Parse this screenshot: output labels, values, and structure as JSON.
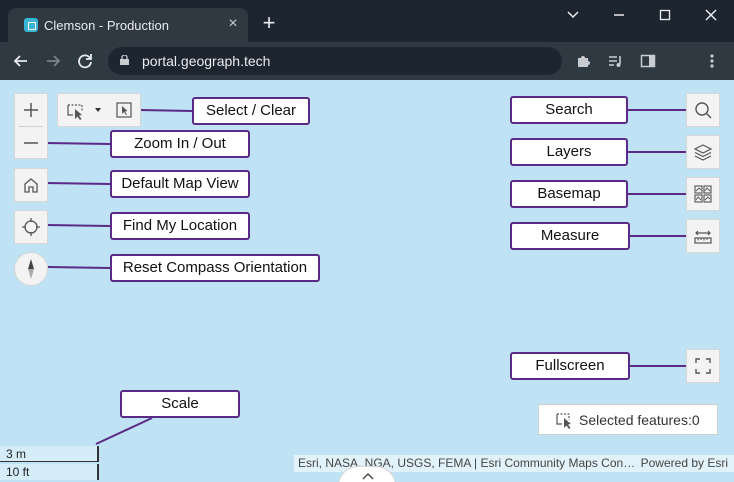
{
  "browser": {
    "tab_title": "Clemson - Production",
    "url": "portal.geograph.tech",
    "new_tab_label": "+",
    "tab_close_label": "×"
  },
  "map_controls": {
    "left": [
      "zoom-in",
      "zoom-out",
      "default-map-view",
      "find-my-location",
      "reset-compass"
    ],
    "right": [
      "search",
      "layers",
      "basemap",
      "measure",
      "fullscreen"
    ]
  },
  "callouts": {
    "select_clear": "Select / Clear",
    "zoom": "Zoom In / Out",
    "default_view": "Default Map View",
    "find_location": "Find My Location",
    "reset_compass": "Reset Compass Orientation",
    "search": "Search",
    "layers": "Layers",
    "basemap": "Basemap",
    "measure": "Measure",
    "fullscreen": "Fullscreen",
    "scale": "Scale"
  },
  "selected_features": "Selected features:0",
  "scale": {
    "metric": "3 m",
    "imperial": "10 ft"
  },
  "attribution": {
    "sources": "Esri, NASA, NGA, USGS, FEMA | Esri Community Maps Con…",
    "powered_by": "Powered by Esri"
  },
  "colors": {
    "map_background": "#bfe3f5",
    "callout_border": "#5b2a86",
    "chrome_dark": "#1d2630",
    "chrome_mid": "#2f3942"
  }
}
